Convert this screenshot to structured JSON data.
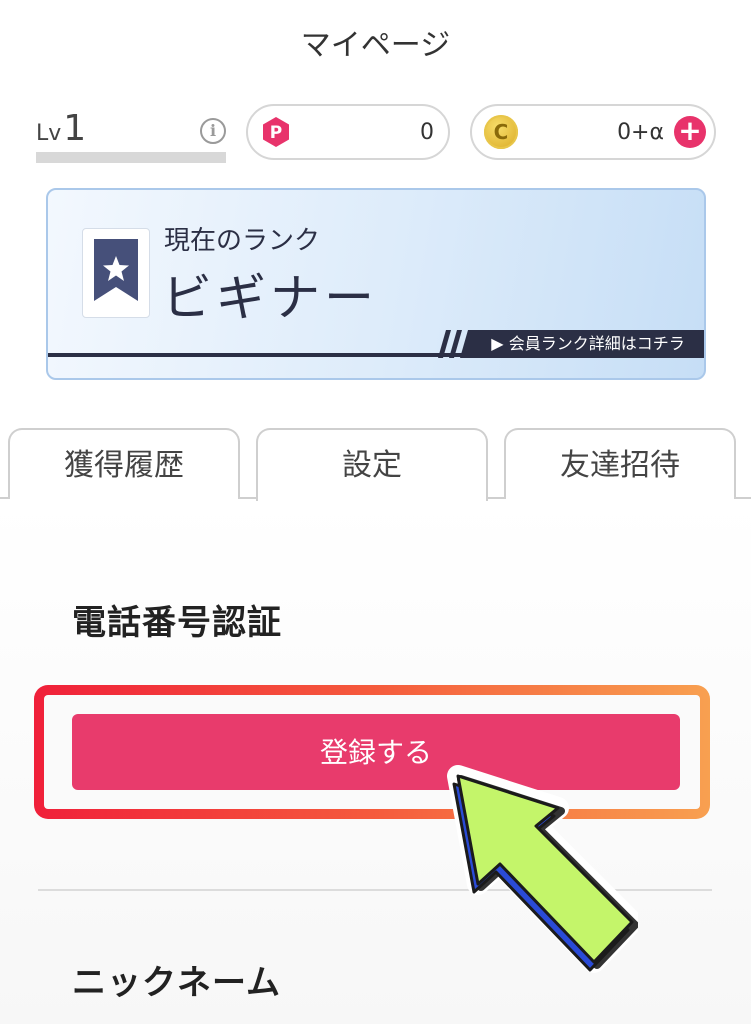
{
  "header": {
    "title": "マイページ"
  },
  "level": {
    "prefix": "Lv",
    "value": "1",
    "info_icon": "info-icon"
  },
  "points": {
    "icon": "P",
    "value": "0"
  },
  "coins": {
    "icon": "C",
    "value": "0+α",
    "add_icon": "plus-icon"
  },
  "rank": {
    "label": "現在のランク",
    "name": "ビギナー",
    "detail_link": "▶ 会員ランク詳細はコチラ"
  },
  "tabs": [
    {
      "label": "獲得履歴"
    },
    {
      "label": "設定"
    },
    {
      "label": "友達招待"
    }
  ],
  "settings": {
    "phone_section_title": "電話番号認証",
    "register_button": "登録する",
    "nickname_section_title": "ニックネーム"
  },
  "colors": {
    "accent_pink": "#e83b6c",
    "highlight_red": "#f0203a",
    "highlight_orange": "#f8a050",
    "rank_navy": "#2b2f45",
    "arrow_green": "#c4f56a",
    "arrow_blue": "#2a4bd6"
  }
}
